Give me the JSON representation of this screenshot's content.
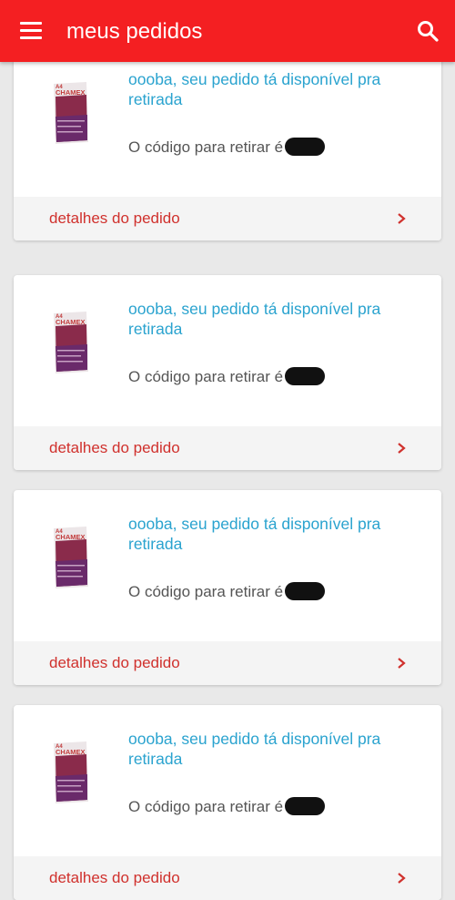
{
  "appbar": {
    "title": "meus pedidos",
    "menu_icon": "hamburger-menu-icon",
    "search_icon": "search-icon"
  },
  "colors": {
    "appbar": "#f41f22",
    "title_link": "#2aa3cf",
    "footer_link": "#d0312d"
  },
  "orders": [
    {
      "title": "oooba, seu pedido tá disponível pra retirada",
      "code_label": "O código para retirar é",
      "details_label": "detalhes do pedido",
      "product_brand": "CHAMEX",
      "product_size": "A4"
    },
    {
      "title": "oooba, seu pedido tá disponível pra retirada",
      "code_label": "O código para retirar é",
      "details_label": "detalhes do pedido",
      "product_brand": "CHAMEX",
      "product_size": "A4"
    },
    {
      "title": "oooba, seu pedido tá disponível pra retirada",
      "code_label": "O código para retirar é",
      "details_label": "detalhes do pedido",
      "product_brand": "CHAMEX",
      "product_size": "A4"
    },
    {
      "title": "oooba, seu pedido tá disponível pra retirada",
      "code_label": "O código para retirar é",
      "details_label": "detalhes do pedido",
      "product_brand": "CHAMEX",
      "product_size": "A4"
    }
  ]
}
